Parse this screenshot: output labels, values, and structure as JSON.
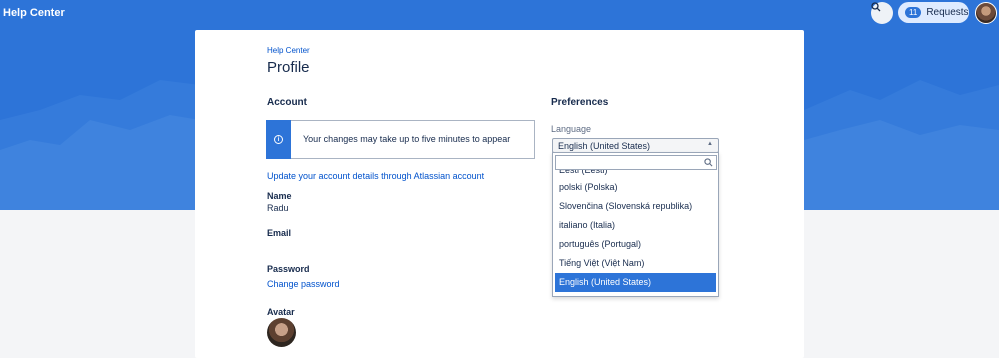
{
  "header": {
    "title": "Help Center",
    "requests_count": "11",
    "requests_label": "Requests"
  },
  "profile": {
    "breadcrumb": "Help Center",
    "title": "Profile"
  },
  "account": {
    "heading": "Account",
    "info_message": "Your changes may take up to five minutes to appear",
    "update_link": "Update your account details through Atlassian account",
    "name_label": "Name",
    "name_value": "Radu",
    "email_label": "Email",
    "password_label": "Password",
    "change_password_link": "Change password",
    "avatar_label": "Avatar"
  },
  "preferences": {
    "heading": "Preferences",
    "language_label": "Language",
    "language_selected": "English (United States)",
    "options": [
      "Eesti (Eesti)",
      "polski (Polska)",
      "Slovenčina (Slovenská republika)",
      "italiano (Italia)",
      "português (Portugal)",
      "Tiếng Việt (Việt Nam)",
      "English (United States)"
    ]
  },
  "colors": {
    "brand_blue": "#2d74d8",
    "link": "#0052cc"
  }
}
